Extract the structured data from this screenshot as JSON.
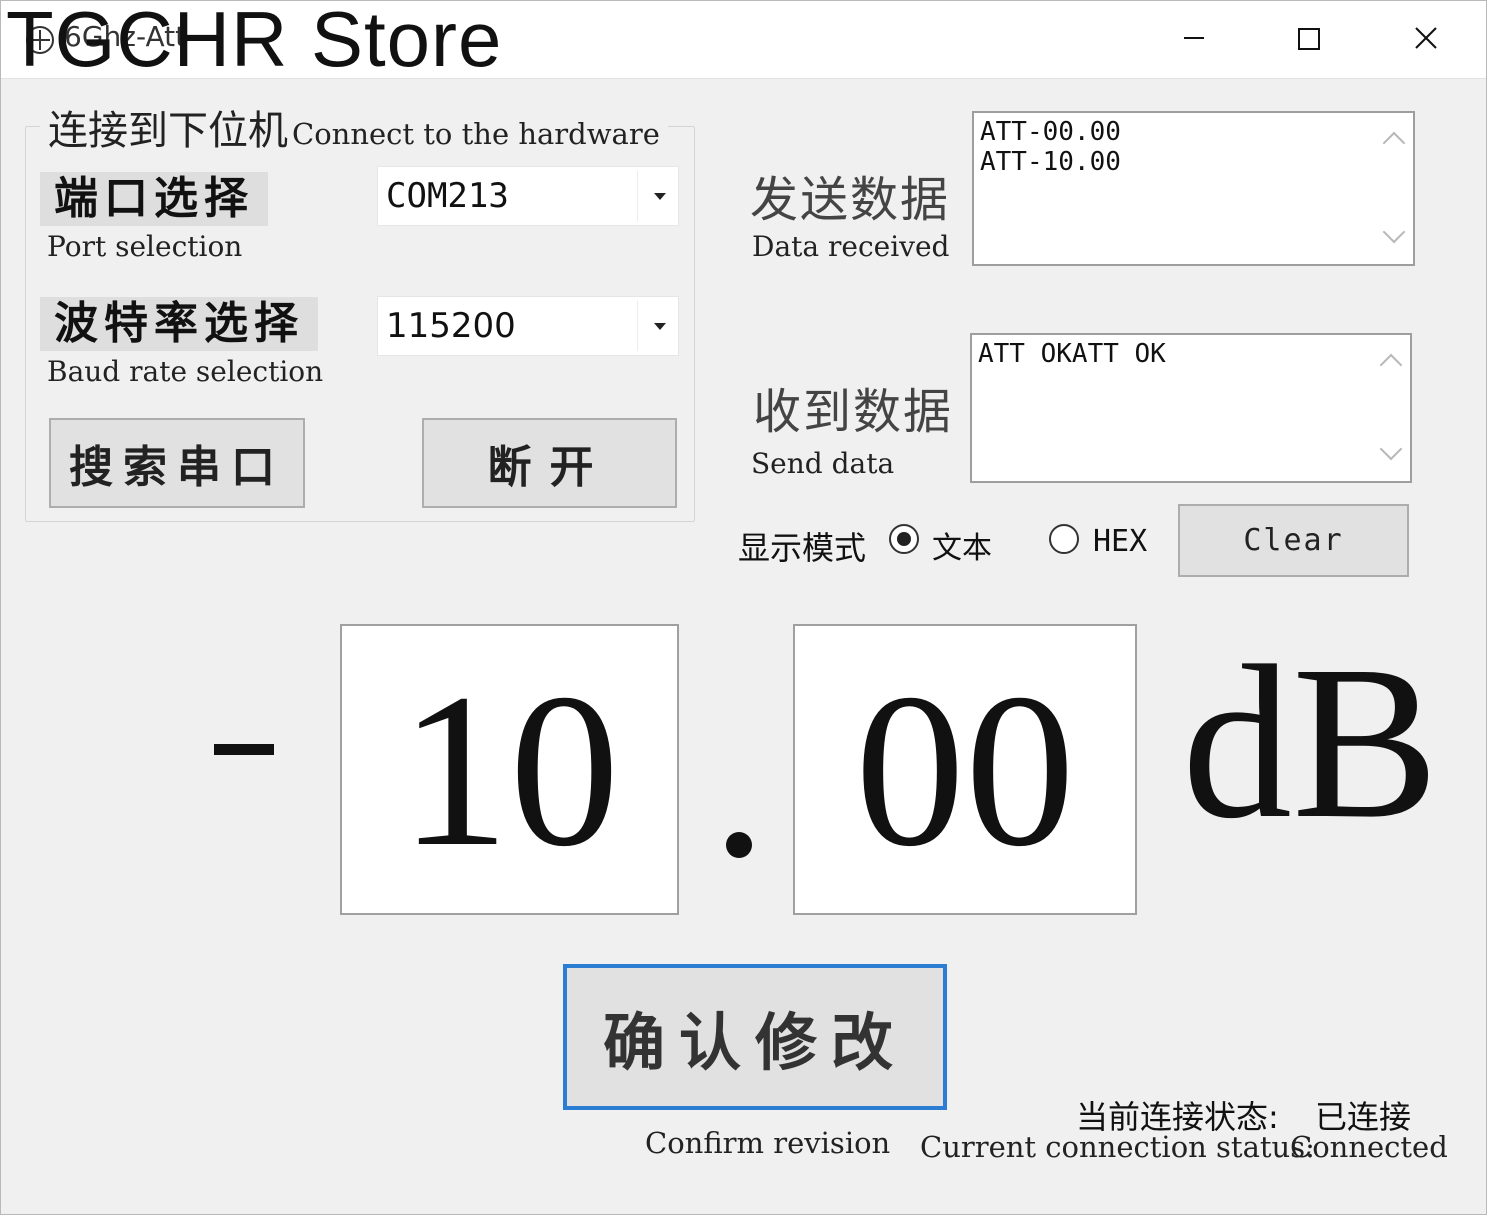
{
  "window": {
    "title": "6Ghz-Att",
    "watermark": "TGCHR Store"
  },
  "connect_group": {
    "title_cn": "连接到下位机",
    "title_en": "Connect to the  hardware",
    "port_label_cn": "端口选择",
    "port_label_en": "Port selection",
    "port_value": "COM213",
    "baud_label_cn": "波特率选择",
    "baud_label_en": "Baud rate selection",
    "baud_value": "115200",
    "search_button": "搜索串口",
    "disconnect_button": "断开"
  },
  "send_panel": {
    "label_cn": "发送数据",
    "label_en": "Data received",
    "lines": [
      "ATT-00.00",
      "ATT-10.00"
    ]
  },
  "receive_panel": {
    "label_cn": "收到数据",
    "label_en": "Send data",
    "lines": [
      "ATT OKATT OK"
    ]
  },
  "display_mode": {
    "label": "显示模式",
    "options": [
      "文本",
      "HEX"
    ],
    "selected": "文本",
    "clear_button": "Clear"
  },
  "attenuation": {
    "sign": "-",
    "integer": "10",
    "decimal": "00",
    "unit": "dB"
  },
  "confirm": {
    "button": "确认修改",
    "caption": "Confirm revision"
  },
  "status": {
    "label_cn": "当前连接状态:",
    "value_cn": "已连接",
    "label_en": "Current connection status:",
    "value_en": "Connected"
  }
}
